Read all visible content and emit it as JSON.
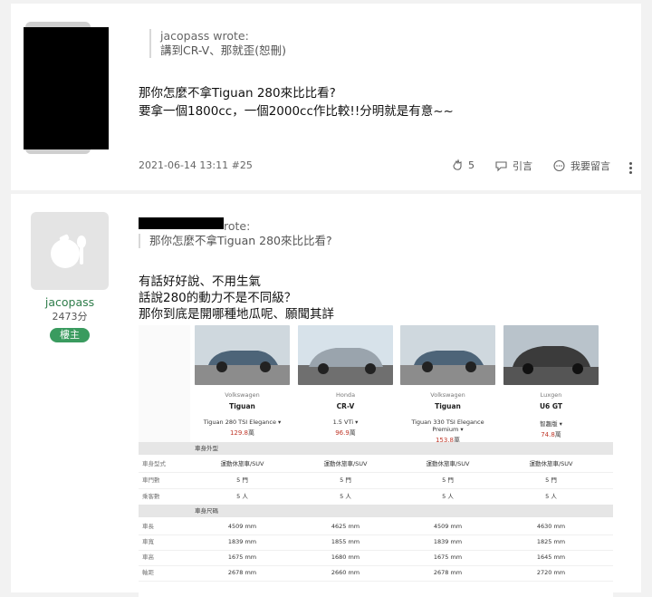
{
  "post1": {
    "quote_author": "jacopass wrote:",
    "quote_text": "講到CR-V、那就歪(恕刪)",
    "body_lines": [
      "那你怎麼不拿Tiguan 280來比比看?",
      "要拿一個1800cc，一個2000cc作比較!!分明就是有意~~"
    ],
    "timestamp": "2021-06-14 13:11 #25",
    "like_count": "5",
    "quote_label": "引言",
    "reply_label": "我要留言"
  },
  "post2": {
    "author_name": "jacopass",
    "author_score": "2473分",
    "badge": "樓主",
    "quote_author_suffix": "rote:",
    "quote_text": "那你怎麼不拿Tiguan 280來比比看?",
    "body_lines": [
      "有話好好說、不用生氣",
      "話說280的動力不是不同級？",
      "那你到底是開哪種地瓜呢、願聞其詳"
    ]
  },
  "comparison": {
    "cars": [
      {
        "brand": "Volkswagen",
        "model": "Tiguan",
        "trim": "Tiguan 280 TSI Elegance ▾",
        "price_value": "129.8",
        "price_unit": "萬",
        "color": "#4d6478"
      },
      {
        "brand": "Honda",
        "model": "CR-V",
        "trim": "1.5 VTi ▾",
        "price_value": "96.9",
        "price_unit": "萬",
        "color": "#9aa4ad"
      },
      {
        "brand": "Volkswagen",
        "model": "Tiguan",
        "trim": "Tiguan 330 TSI Elegance Premium ▾",
        "price_value": "153.8",
        "price_unit": "萬",
        "color": "#4d6478"
      },
      {
        "brand": "Luxgen",
        "model": "U6 GT",
        "trim": "智趣版 ▾",
        "price_value": "74.8",
        "price_unit": "萬",
        "color": "#3b3b3b"
      }
    ],
    "section1": "車身外型",
    "rows1": [
      {
        "label": "車身型式",
        "values": [
          "運動休旅車/SUV",
          "運動休旅車/SUV",
          "運動休旅車/SUV",
          "運動休旅車/SUV"
        ]
      },
      {
        "label": "車門數",
        "values": [
          "5 門",
          "5 門",
          "5 門",
          "5 門"
        ]
      },
      {
        "label": "乘客數",
        "values": [
          "5 人",
          "5 人",
          "5 人",
          "5 人"
        ]
      }
    ],
    "section2": "車身尺碼",
    "rows2": [
      {
        "label": "車長",
        "values": [
          "4509 mm",
          "4625 mm",
          "4509 mm",
          "4630 mm"
        ]
      },
      {
        "label": "車寬",
        "values": [
          "1839 mm",
          "1855 mm",
          "1839 mm",
          "1825 mm"
        ]
      },
      {
        "label": "車高",
        "values": [
          "1675 mm",
          "1680 mm",
          "1675 mm",
          "1645 mm"
        ]
      },
      {
        "label": "軸距",
        "values": [
          "2678 mm",
          "2660 mm",
          "2678 mm",
          "2720 mm"
        ]
      }
    ]
  }
}
